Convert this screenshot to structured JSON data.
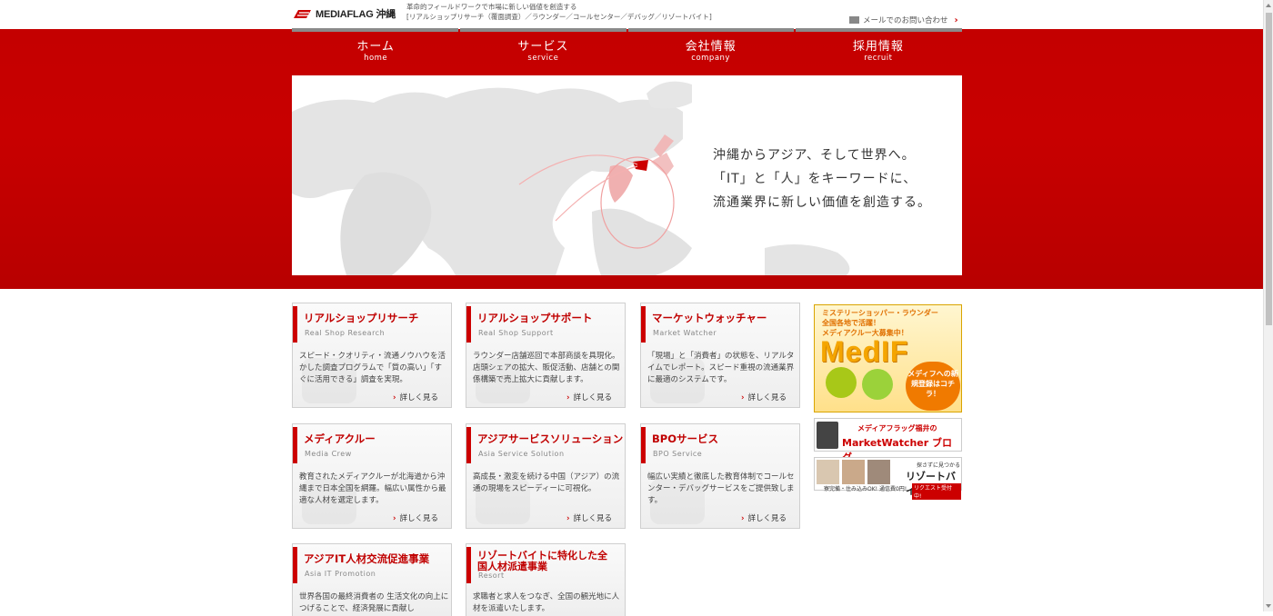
{
  "header": {
    "logo_text": "MEDIAFLAG 沖縄",
    "tagline_1": "革命的フィールドワークで市場に新しい価値を創造する",
    "tagline_2": "[リアルショップリサーチ（覆面調査）／ラウンダー／コールセンター／デバッグ／リゾートバイト]",
    "contact_label": "メールでのお問い合わせ"
  },
  "nav": [
    {
      "jp": "ホーム",
      "en": "home"
    },
    {
      "jp": "サービス",
      "en": "service"
    },
    {
      "jp": "会社情報",
      "en": "company"
    },
    {
      "jp": "採用情報",
      "en": "recruit"
    }
  ],
  "hero": {
    "line1": "沖縄からアジア、そして世界へ。",
    "line2": "「IT」と「人」をキーワードに、",
    "line3": "流通業界に新しい価値を創造する。"
  },
  "services": [
    {
      "title": "リアルショップリサーチ",
      "sub": "Real Shop Research",
      "desc": "スピード・クオリティ・流通ノウハウを活かした調査プログラムで「質の高い」「すぐに活用できる」調査を実現。",
      "more": "詳しく見る"
    },
    {
      "title": "リアルショップサポート",
      "sub": "Real Shop Support",
      "desc": "ラウンダー店舗巡回で本部商談を具現化。店頭シェアの拡大、販促活動、店舗との関係構築で売上拡大に貢献します。",
      "more": "詳しく見る"
    },
    {
      "title": "マーケットウォッチャー",
      "sub": "Market Watcher",
      "desc": "「現場」と「消費者」の状態を、リアルタイムでレポート。スピード重視の流通業界に最適のシステムです。",
      "more": "詳しく見る"
    },
    {
      "title": "メディアクルー",
      "sub": "Media Crew",
      "desc": "教育されたメディアクルーが北海道から沖縄まで日本全国を網羅。幅広い属性から最適な人材を選定します。",
      "more": "詳しく見る"
    },
    {
      "title": "アジアサービスソリューション",
      "sub": "Asia Service Solution",
      "desc": "高成長・激変を続ける中国（アジア）の流通の現場をスピーディーに可視化。",
      "more": "詳しく見る"
    },
    {
      "title": "BPOサービス",
      "sub": "BPO Service",
      "desc": "幅広い実績と徹底した教育体制でコールセンター・デバッグサービスをご提供致します。",
      "more": "詳しく見る"
    },
    {
      "title": "アジアIT人材交流促進事業",
      "sub": "Asia IT Promotion",
      "desc": "世界各国の最終消費者の 生活文化の向上につげることで、経済発展に貢献し"
    },
    {
      "title": "リゾートバイトに特化した全国人材派遣事業",
      "sub": "Resort",
      "desc": "求職者と求人をつなぎ、全国の観光地に人材を派遣いたします。"
    }
  ],
  "banners": {
    "medif_l1": "ミステリーショッパー・ラウンダー",
    "medif_l2": "全国各地で活躍！",
    "medif_l3": "メディアクルー大募集中！",
    "medif_brand": "MedIF",
    "medif_cta": "メディフへの新規登録はコチラ！",
    "mw_l1": "メディアフラッグ福井の",
    "mw_l2": "MarketWatcher ブログ",
    "resort_l1": "探さずに見つかる",
    "resort_l2": "リゾートバイト",
    "resort_l3": "寮完備・住み込みOK! 通信費0円!",
    "resort_l4": "リクエスト受付中!"
  },
  "colors": {
    "brand_red": "#c40000",
    "text_red": "#c00000",
    "accent_orange": "#f07a00"
  },
  "icons": [
    "mail-icon",
    "chevron-right-icon",
    "logo-flag-icon"
  ]
}
